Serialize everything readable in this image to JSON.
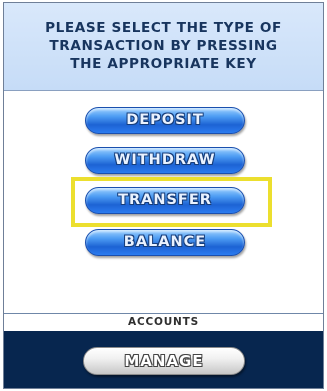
{
  "header": {
    "instruction": "PLEASE SELECT THE TYPE OF\nTRANSACTION BY PRESSING\nTHE APPROPRIATE KEY"
  },
  "menu": {
    "buttons": [
      {
        "label": "DEPOSIT"
      },
      {
        "label": "WITHDRAW"
      },
      {
        "label": "TRANSFER"
      },
      {
        "label": "BALANCE"
      }
    ],
    "highlighted": "TRANSFER",
    "highlight_color": "#ecdf2e",
    "button_color": "#2b7cf0"
  },
  "accounts": {
    "label": "ACCOUNTS",
    "manage_label": "MANAGE"
  },
  "colors": {
    "header_background": "#c6dcf7",
    "footer_background": "#07264f"
  }
}
